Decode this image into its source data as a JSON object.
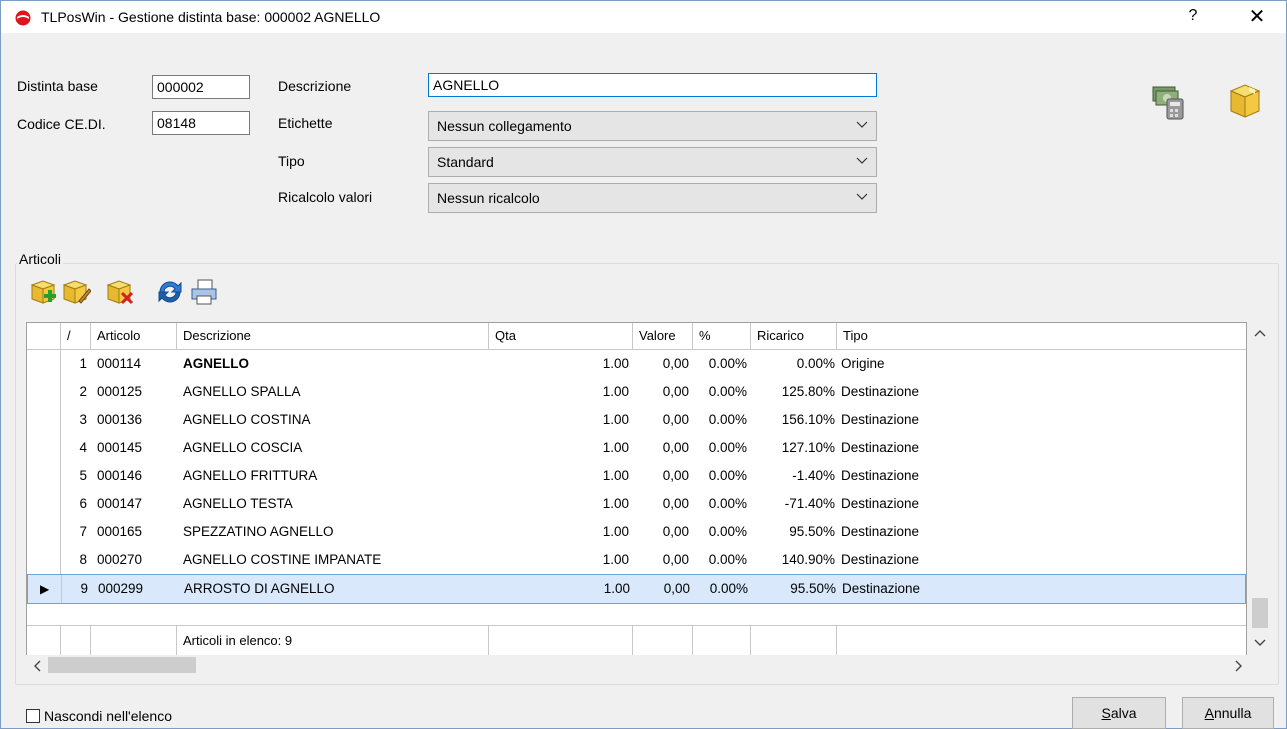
{
  "title": {
    "app_title": "TLPosWin - Gestione distinta base: 000002 AGNELLO",
    "help_glyph": "?",
    "close_glyph": "✕",
    "brand_color": "#e0141b"
  },
  "form": {
    "distinta_label": "Distinta base",
    "distinta_value": "000002",
    "codice_label": "Codice CE.DI.",
    "codice_value": "08148",
    "descrizione_label": "Descrizione",
    "descrizione_value": "AGNELLO",
    "etichette_label": "Etichette",
    "etichette_value": "Nessun collegamento",
    "tipo_label": "Tipo",
    "tipo_value": "Standard",
    "ricalcolo_label": "Ricalcolo valori",
    "ricalcolo_value": "Nessun ricalcolo"
  },
  "articoli": {
    "group_label": "Articoli",
    "columns": [
      "/",
      "Articolo",
      "Descrizione",
      "Qta",
      "Valore",
      "%",
      "Ricarico",
      "Tipo"
    ],
    "rows": [
      {
        "n": "1",
        "articolo": "000114",
        "descrizione": "AGNELLO",
        "qta": "1.00",
        "valore": "0,00",
        "pct": "0.00%",
        "ricarico": "0.00%",
        "tipo": "Origine"
      },
      {
        "n": "2",
        "articolo": "000125",
        "descrizione": "AGNELLO SPALLA",
        "qta": "1.00",
        "valore": "0,00",
        "pct": "0.00%",
        "ricarico": "125.80%",
        "tipo": "Destinazione"
      },
      {
        "n": "3",
        "articolo": "000136",
        "descrizione": "AGNELLO COSTINA",
        "qta": "1.00",
        "valore": "0,00",
        "pct": "0.00%",
        "ricarico": "156.10%",
        "tipo": "Destinazione"
      },
      {
        "n": "4",
        "articolo": "000145",
        "descrizione": "AGNELLO COSCIA",
        "qta": "1.00",
        "valore": "0,00",
        "pct": "0.00%",
        "ricarico": "127.10%",
        "tipo": "Destinazione"
      },
      {
        "n": "5",
        "articolo": "000146",
        "descrizione": "AGNELLO FRITTURA",
        "qta": "1.00",
        "valore": "0,00",
        "pct": "0.00%",
        "ricarico": "-1.40%",
        "tipo": "Destinazione"
      },
      {
        "n": "6",
        "articolo": "000147",
        "descrizione": "AGNELLO TESTA",
        "qta": "1.00",
        "valore": "0,00",
        "pct": "0.00%",
        "ricarico": "-71.40%",
        "tipo": "Destinazione"
      },
      {
        "n": "7",
        "articolo": "000165",
        "descrizione": "SPEZZATINO AGNELLO",
        "qta": "1.00",
        "valore": "0,00",
        "pct": "0.00%",
        "ricarico": "95.50%",
        "tipo": "Destinazione"
      },
      {
        "n": "8",
        "articolo": "000270",
        "descrizione": "AGNELLO COSTINE IMPANATE",
        "qta": "1.00",
        "valore": "0,00",
        "pct": "0.00%",
        "ricarico": "140.90%",
        "tipo": "Destinazione"
      },
      {
        "n": "9",
        "articolo": "000299",
        "descrizione": "ARROSTO DI AGNELLO",
        "qta": "1.00",
        "valore": "0,00",
        "pct": "0.00%",
        "ricarico": "95.50%",
        "tipo": "Destinazione"
      }
    ],
    "footer_count": "Articoli in elenco: 9",
    "current_row_glyph": "▶"
  },
  "bottom": {
    "hide_label": "Nascondi nell'elenco",
    "save_accel": "S",
    "save_rest": "alva",
    "cancel_accel": "A",
    "cancel_rest": "nnulla"
  },
  "colors": {
    "selection_bg": "#d9e9fb",
    "selection_border": "#6aa3dc",
    "focus_border": "#0078d7"
  }
}
